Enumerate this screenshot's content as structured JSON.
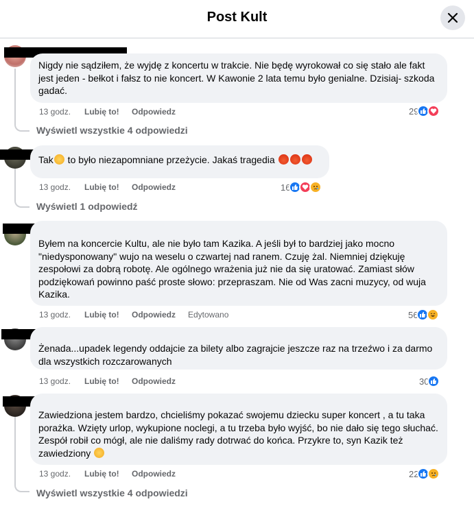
{
  "header": {
    "title": "Post Kult"
  },
  "comments": [
    {
      "text": "Nigdy nie sądziłem, że wyjdę z koncertu w trakcie. Nie będę wyrokował co się stało ale fakt jest jeden - bełkot i fałsz to nie koncert. W Kawonie 2 lata temu było genialne. Dzisiaj- szkoda gadać.",
      "time": "13 godz.",
      "like_label": "Lubię to!",
      "reply_label": "Odpowiedz",
      "reaction_count": "29",
      "reactions": [
        "like",
        "love"
      ],
      "view_replies": "Wyświetl wszystkie 4 odpowiedzi"
    },
    {
      "text_before": "Tak",
      "text_after": " to było niezapomniane przeżycie. Jakaś tragedia ",
      "time": "13 godz.",
      "like_label": "Lubię to!",
      "reply_label": "Odpowiedz",
      "reaction_count": "16",
      "reactions": [
        "like",
        "love",
        "sad"
      ],
      "view_replies": "Wyświetl 1 odpowiedź"
    },
    {
      "text": "Byłem na koncercie Kultu, ale nie było tam Kazika. A jeśli był to bardziej jako mocno \"niedysponowany\" wujo na weselu o czwartej nad ranem. Czuję żal. Niemniej dziękuję zespołowi za dobrą robotę. Ale ogólnego wrażenia już nie da się uratować. Zamiast słów podziękowań powinno paść proste słowo: przepraszam. Nie od Was zacni muzycy, od wuja Kazika.",
      "time": "13 godz.",
      "like_label": "Lubię to!",
      "reply_label": "Odpowiedz",
      "edited_label": "Edytowano",
      "reaction_count": "56",
      "reactions": [
        "like",
        "haha"
      ]
    },
    {
      "text": "Żenada...upadek legendy oddajcie za bilety albo zagrajcie jeszcze raz na trzeźwo i za darmo dla wszystkich rozczarowanych",
      "time": "13 godz.",
      "like_label": "Lubię to!",
      "reply_label": "Odpowiedz",
      "reaction_count": "30",
      "reactions": [
        "like"
      ]
    },
    {
      "text": "Zawiedziona jestem bardzo, chcieliśmy pokazać swojemu dziecku super koncert , a tu taka porażka. Wzięty urlop, wykupione noclegi, a tu trzeba było wyjść, bo nie dało się tego słuchać. Zespół robił co mógł, ale nie daliśmy rady dotrwać do końca. Przykre to, syn Kazik też zawiedziony ",
      "time": "13 godz.",
      "like_label": "Lubię to!",
      "reply_label": "Odpowiedz",
      "reaction_count": "22",
      "reactions": [
        "like",
        "sad"
      ],
      "view_replies": "Wyświetl wszystkie 4 odpowiedzi"
    }
  ],
  "colors": {
    "like": "#1877f2",
    "love": "#f33e58",
    "sad": "#f7b125",
    "bubble": "#f0f2f5",
    "meta": "#65676b"
  }
}
